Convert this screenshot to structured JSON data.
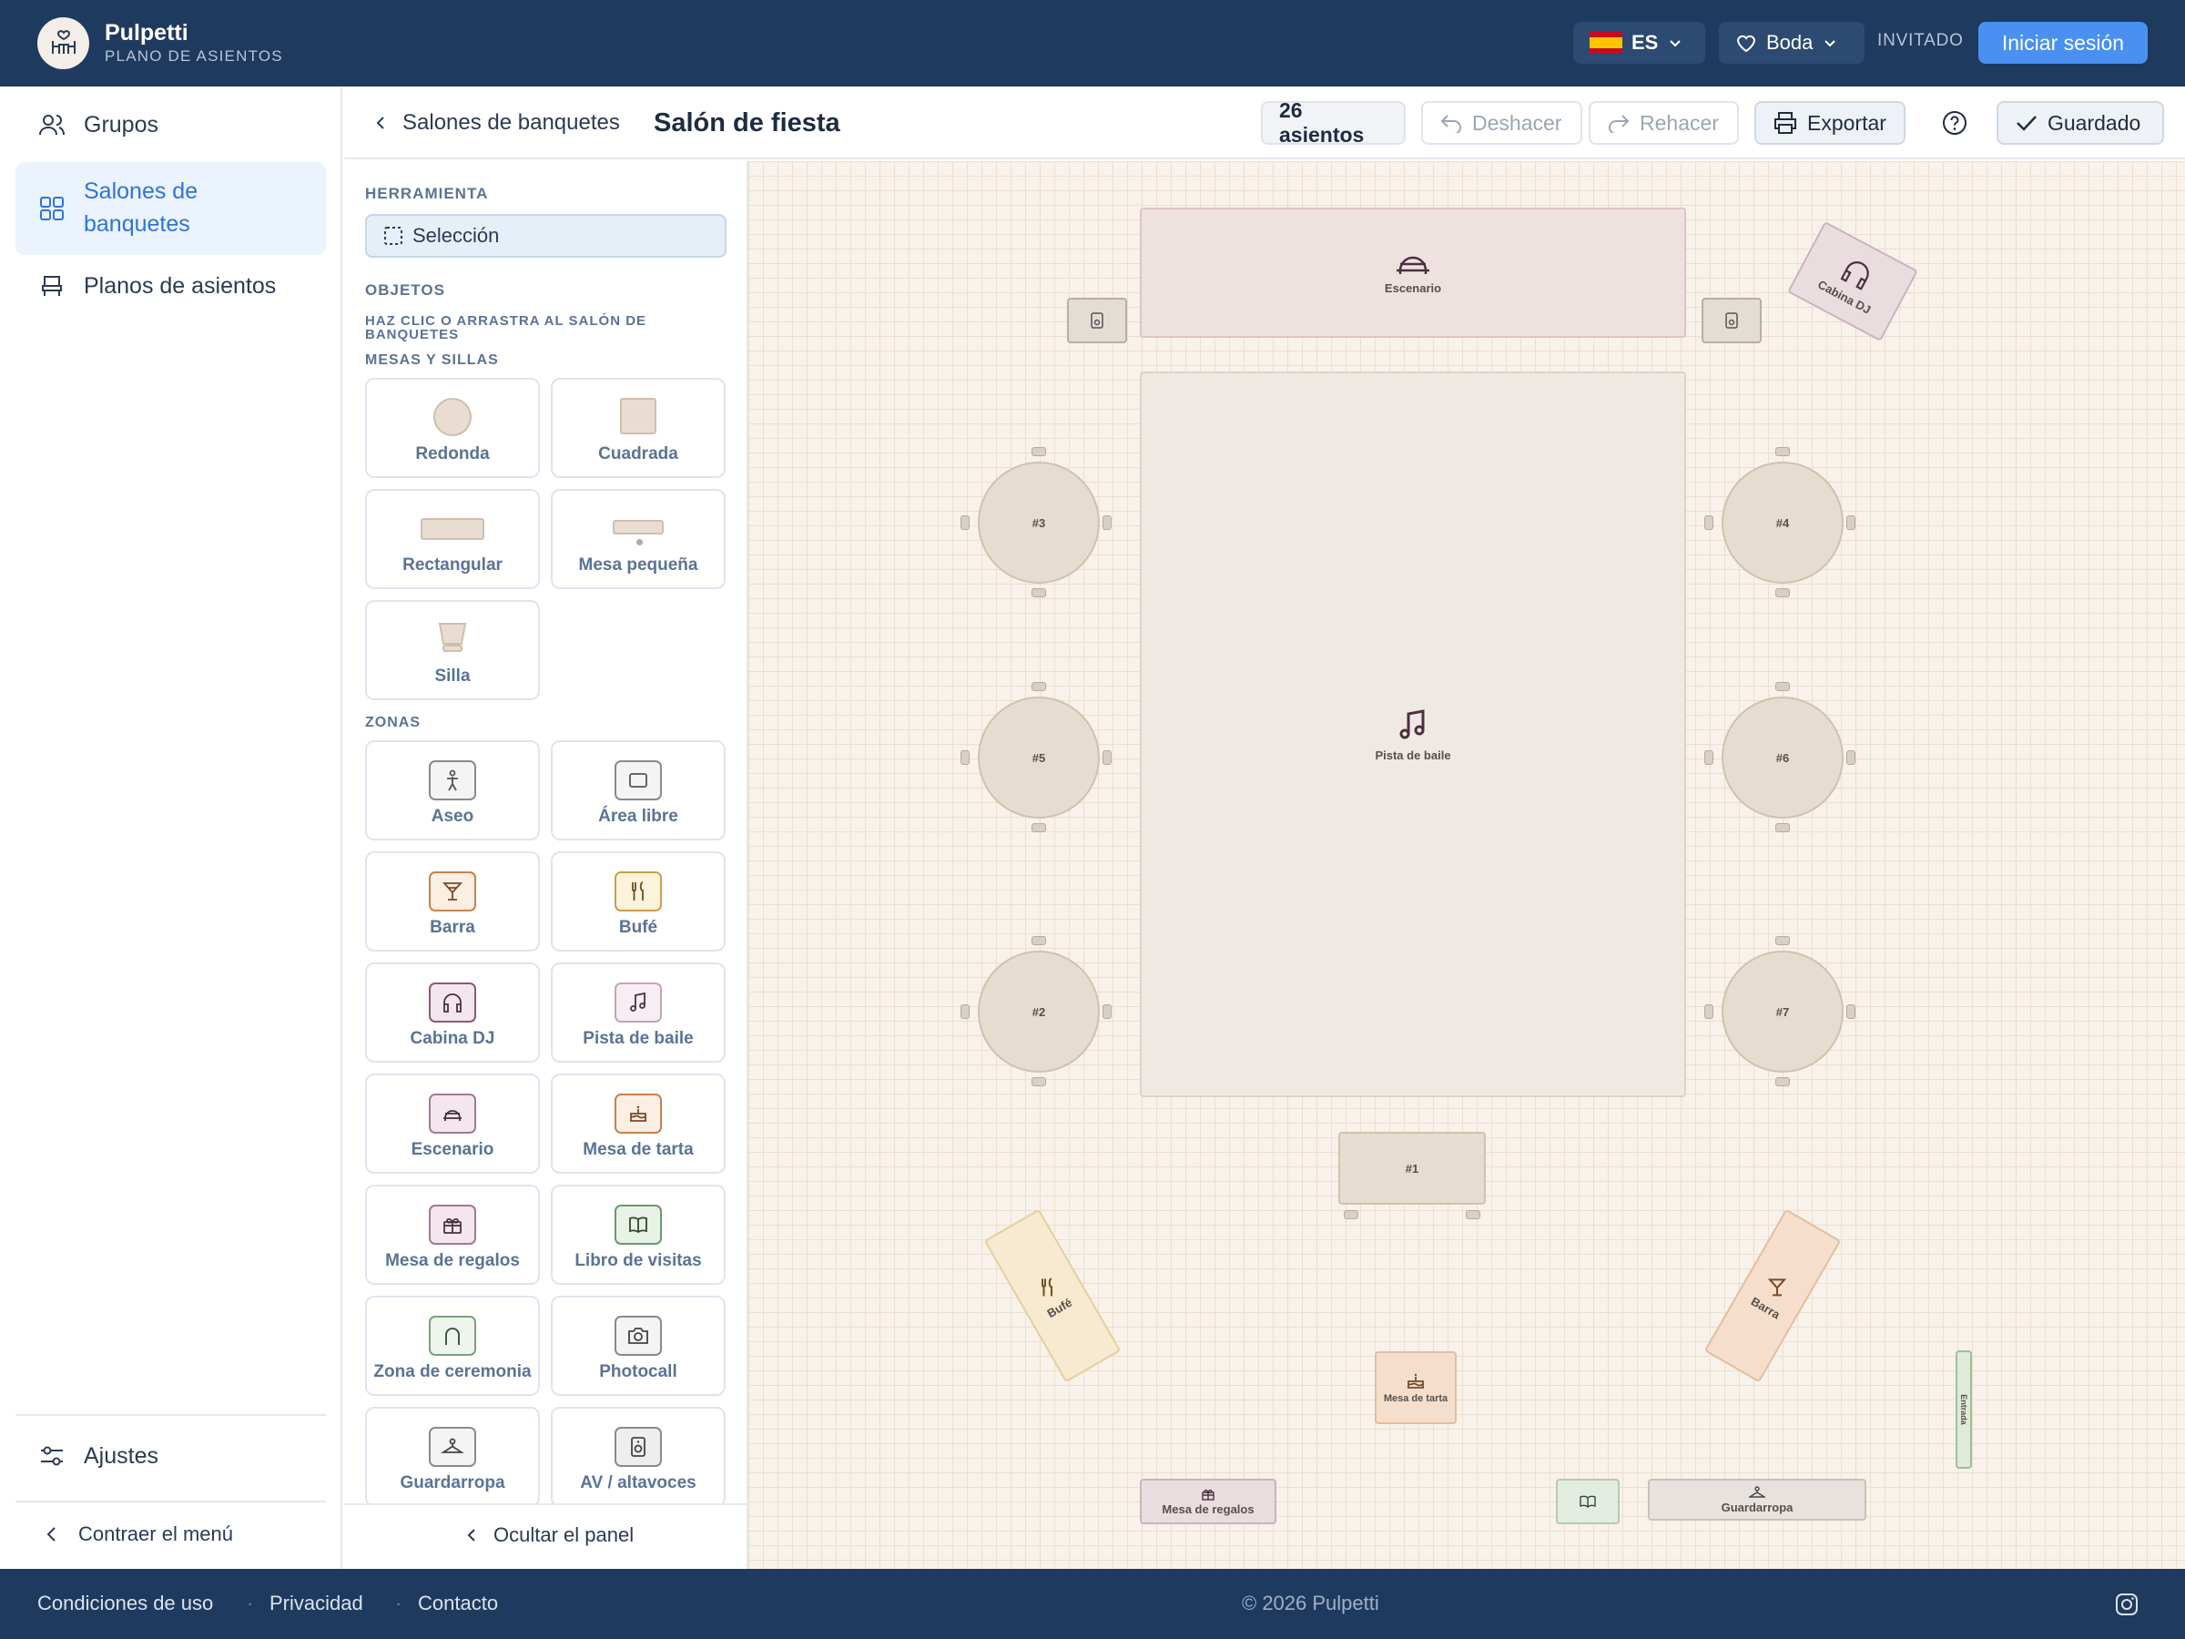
{
  "header": {
    "brand_name": "Pulpetti",
    "brand_subtitle": "PLANO DE ASIENTOS",
    "language": "ES",
    "event": "Boda",
    "guest_label": "INVITADO",
    "login_label": "Iniciar sesión"
  },
  "sidebar": {
    "items": [
      {
        "label": "Grupos",
        "icon": "users-icon"
      },
      {
        "label": "Salones de banquetes",
        "icon": "grid-icon",
        "active": true
      },
      {
        "label": "Planos de asientos",
        "icon": "chair-icon"
      }
    ],
    "settings_label": "Ajustes",
    "collapse_label": "Contraer el menú"
  },
  "toolbar": {
    "back_label": "Salones de banquetes",
    "title": "Salón de fiesta",
    "seat_count": "26 asientos",
    "undo_label": "Deshacer",
    "redo_label": "Rehacer",
    "export_label": "Exportar",
    "saved_label": "Guardado"
  },
  "panel": {
    "tool_heading": "HERRAMIENTA",
    "tool_selection": "Selección",
    "objects_heading": "OBJETOS",
    "objects_hint": "HAZ CLIC O ARRASTRA AL SALÓN DE BANQUETES",
    "tables_heading": "MESAS Y SILLAS",
    "tables": [
      "Redonda",
      "Cuadrada",
      "Rectangular",
      "Mesa pequeña",
      "Silla"
    ],
    "zones_heading": "ZONAS",
    "zones": [
      {
        "label": "Aseo",
        "icon": "restroom-icon",
        "color": "#7a7a7a"
      },
      {
        "label": "Área libre",
        "icon": "square-icon",
        "color": "#7a7a7a"
      },
      {
        "label": "Barra",
        "icon": "cocktail-icon",
        "color": "#c8824a"
      },
      {
        "label": "Bufé",
        "icon": "cutlery-icon",
        "color": "#c9a04a"
      },
      {
        "label": "Cabina DJ",
        "icon": "headphones-icon",
        "color": "#8a5a78"
      },
      {
        "label": "Pista de baile",
        "icon": "music-note-icon",
        "color": "#9a6a88"
      },
      {
        "label": "Escenario",
        "icon": "stage-icon",
        "color": "#9a6a88"
      },
      {
        "label": "Mesa de tarta",
        "icon": "cake-icon",
        "color": "#c8824a"
      },
      {
        "label": "Mesa de regalos",
        "icon": "gift-icon",
        "color": "#9a6a88"
      },
      {
        "label": "Libro de visitas",
        "icon": "book-icon",
        "color": "#6a9a6a"
      },
      {
        "label": "Zona de ceremonia",
        "icon": "arch-icon",
        "color": "#6a9a6a"
      },
      {
        "label": "Photocall",
        "icon": "camera-icon",
        "color": "#7a7a7a"
      },
      {
        "label": "Guardarropa",
        "icon": "hanger-icon",
        "color": "#7a7a7a"
      },
      {
        "label": "AV / altavoces",
        "icon": "speaker-icon",
        "color": "#7a7a7a"
      }
    ],
    "hide_label": "Ocultar el panel"
  },
  "canvas": {
    "stage": "Escenario",
    "dj": "Cabina DJ",
    "dance_floor": "Pista de baile",
    "tables": [
      "#3",
      "#4",
      "#5",
      "#6",
      "#2",
      "#7",
      "#1"
    ],
    "buffet": "Bufé",
    "bar": "Barra",
    "cake": "Mesa de tarta",
    "gifts": "Mesa de regalos",
    "cloakroom": "Guardarropa",
    "entrance": "Entrada"
  },
  "footer": {
    "links": [
      "Condiciones de uso",
      "Privacidad",
      "Contacto"
    ],
    "copyright": "© 2026 Pulpetti"
  }
}
